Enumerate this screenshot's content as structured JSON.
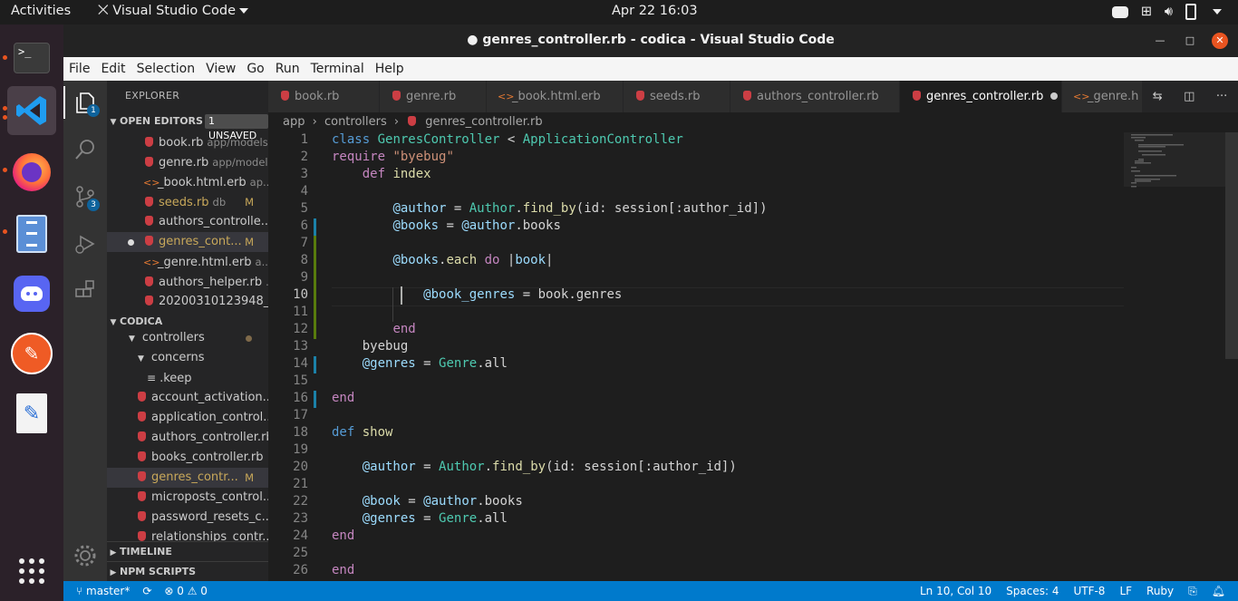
{
  "topbar": {
    "activities": "Activities",
    "app_name": "Visual Studio Code",
    "clock": "Apr 22  16:03"
  },
  "window": {
    "title": "● genres_controller.rb - codica - Visual Studio Code"
  },
  "menu": [
    "File",
    "Edit",
    "Selection",
    "View",
    "Go",
    "Run",
    "Terminal",
    "Help"
  ],
  "activity_badges": {
    "explorer": "1",
    "scm": "3"
  },
  "sidebar": {
    "title": "EXPLORER",
    "open_editors_label": "OPEN EDITORS",
    "unsaved_badge": "1 UNSAVED",
    "open_editors": [
      {
        "icon": "ruby-icon",
        "name": "book.rb",
        "desc": "app/models",
        "flag": ""
      },
      {
        "icon": "ruby-icon",
        "name": "genre.rb",
        "desc": "app/models",
        "flag": ""
      },
      {
        "icon": "erb-icon",
        "name": "_book.html.erb",
        "desc": "ap...",
        "flag": ""
      },
      {
        "icon": "ruby-icon",
        "name": "seeds.rb",
        "desc": "db",
        "flag": "M"
      },
      {
        "icon": "ruby-icon",
        "name": "authors_controlle...",
        "desc": "",
        "flag": ""
      },
      {
        "icon": "ruby-icon",
        "name": "genres_cont...",
        "desc": "",
        "flag": "M"
      },
      {
        "icon": "erb-icon",
        "name": "_genre.html.erb",
        "desc": "a...",
        "flag": ""
      },
      {
        "icon": "ruby-icon",
        "name": "authors_helper.rb",
        "desc": "...",
        "flag": ""
      },
      {
        "icon": "ruby-icon",
        "name": "20200310123948_...",
        "desc": "",
        "flag": ""
      }
    ],
    "project_label": "CODICA",
    "tree": [
      {
        "name": "controllers",
        "type": "folder-open"
      },
      {
        "name": "concerns",
        "type": "folder-open"
      },
      {
        "name": ".keep",
        "type": "file"
      },
      {
        "name": "account_activation...",
        "type": "ruby"
      },
      {
        "name": "application_control...",
        "type": "ruby"
      },
      {
        "name": "authors_controller.rb",
        "type": "ruby"
      },
      {
        "name": "books_controller.rb",
        "type": "ruby"
      },
      {
        "name": "genres_contr...",
        "type": "ruby",
        "flag": "M"
      },
      {
        "name": "microposts_control...",
        "type": "ruby"
      },
      {
        "name": "password_resets_c...",
        "type": "ruby"
      },
      {
        "name": "relationships_contr...",
        "type": "ruby"
      }
    ],
    "timeline_label": "TIMELINE",
    "npm_label": "NPM SCRIPTS"
  },
  "tabs": [
    {
      "name": "book.rb",
      "icon": "ruby-icon"
    },
    {
      "name": "genre.rb",
      "icon": "ruby-icon"
    },
    {
      "name": "_book.html.erb",
      "icon": "erb-icon"
    },
    {
      "name": "seeds.rb",
      "icon": "ruby-icon"
    },
    {
      "name": "authors_controller.rb",
      "icon": "ruby-icon"
    },
    {
      "name": "genres_controller.rb",
      "icon": "ruby-icon"
    },
    {
      "name": "_genre.h",
      "icon": "erb-icon"
    }
  ],
  "breadcrumb": [
    "app",
    "controllers",
    "genres_controller.rb"
  ],
  "editor": {
    "line_numbers": [
      "1",
      "2",
      "3",
      "4",
      "5",
      "6",
      "7",
      "8",
      "9",
      "10",
      "11",
      "12",
      "13",
      "14",
      "15",
      "16",
      "17",
      "18",
      "19",
      "20",
      "21",
      "22",
      "23",
      "24",
      "25",
      "26"
    ]
  },
  "statusbar": {
    "branch": "master*",
    "problems": "⊗ 0 ⚠ 0",
    "position": "Ln 10, Col 10",
    "spaces": "Spaces: 4",
    "encoding": "UTF-8",
    "eol": "LF",
    "language": "Ruby"
  }
}
